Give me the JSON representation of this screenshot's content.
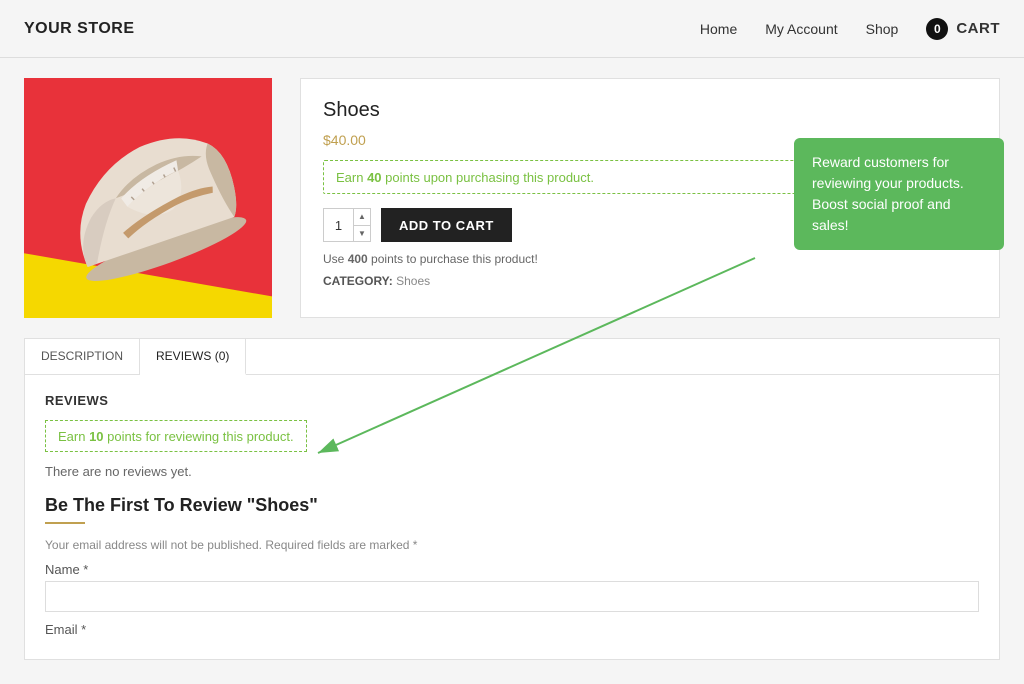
{
  "header": {
    "logo": "YOUR STORE",
    "nav": {
      "home": "Home",
      "my_account": "My Account",
      "shop": "Shop"
    },
    "cart": {
      "count": "0",
      "label": "CART"
    }
  },
  "product": {
    "title": "Shoes",
    "price": "$40.00",
    "earn_points_msg_pre": "Earn ",
    "earn_points_amount": "40",
    "earn_points_msg_post": " points upon purchasing this product.",
    "quantity": "1",
    "add_to_cart_label": "ADD TO CART",
    "use_points_pre": "Use ",
    "use_points_amount": "400",
    "use_points_post": " points to purchase this product!",
    "category_label": "CATEGORY:",
    "category_value": "Shoes"
  },
  "tabs": {
    "description_label": "DESCRIPTION",
    "reviews_label": "REVIEWS (0)"
  },
  "reviews": {
    "heading": "REVIEWS",
    "earn_review_text_pre": "Earn ",
    "earn_review_points": "10",
    "earn_review_text_post": " points for reviewing this product.",
    "no_reviews": "There are no reviews yet.",
    "form_title": "Be The First To Review \"Shoes\"",
    "form_note": "Your email address will not be published. Required fields are marked *",
    "name_label": "Name *",
    "email_label": "Email *"
  },
  "tooltip": {
    "text": "Reward customers for reviewing your products. Boost social proof and sales!"
  }
}
